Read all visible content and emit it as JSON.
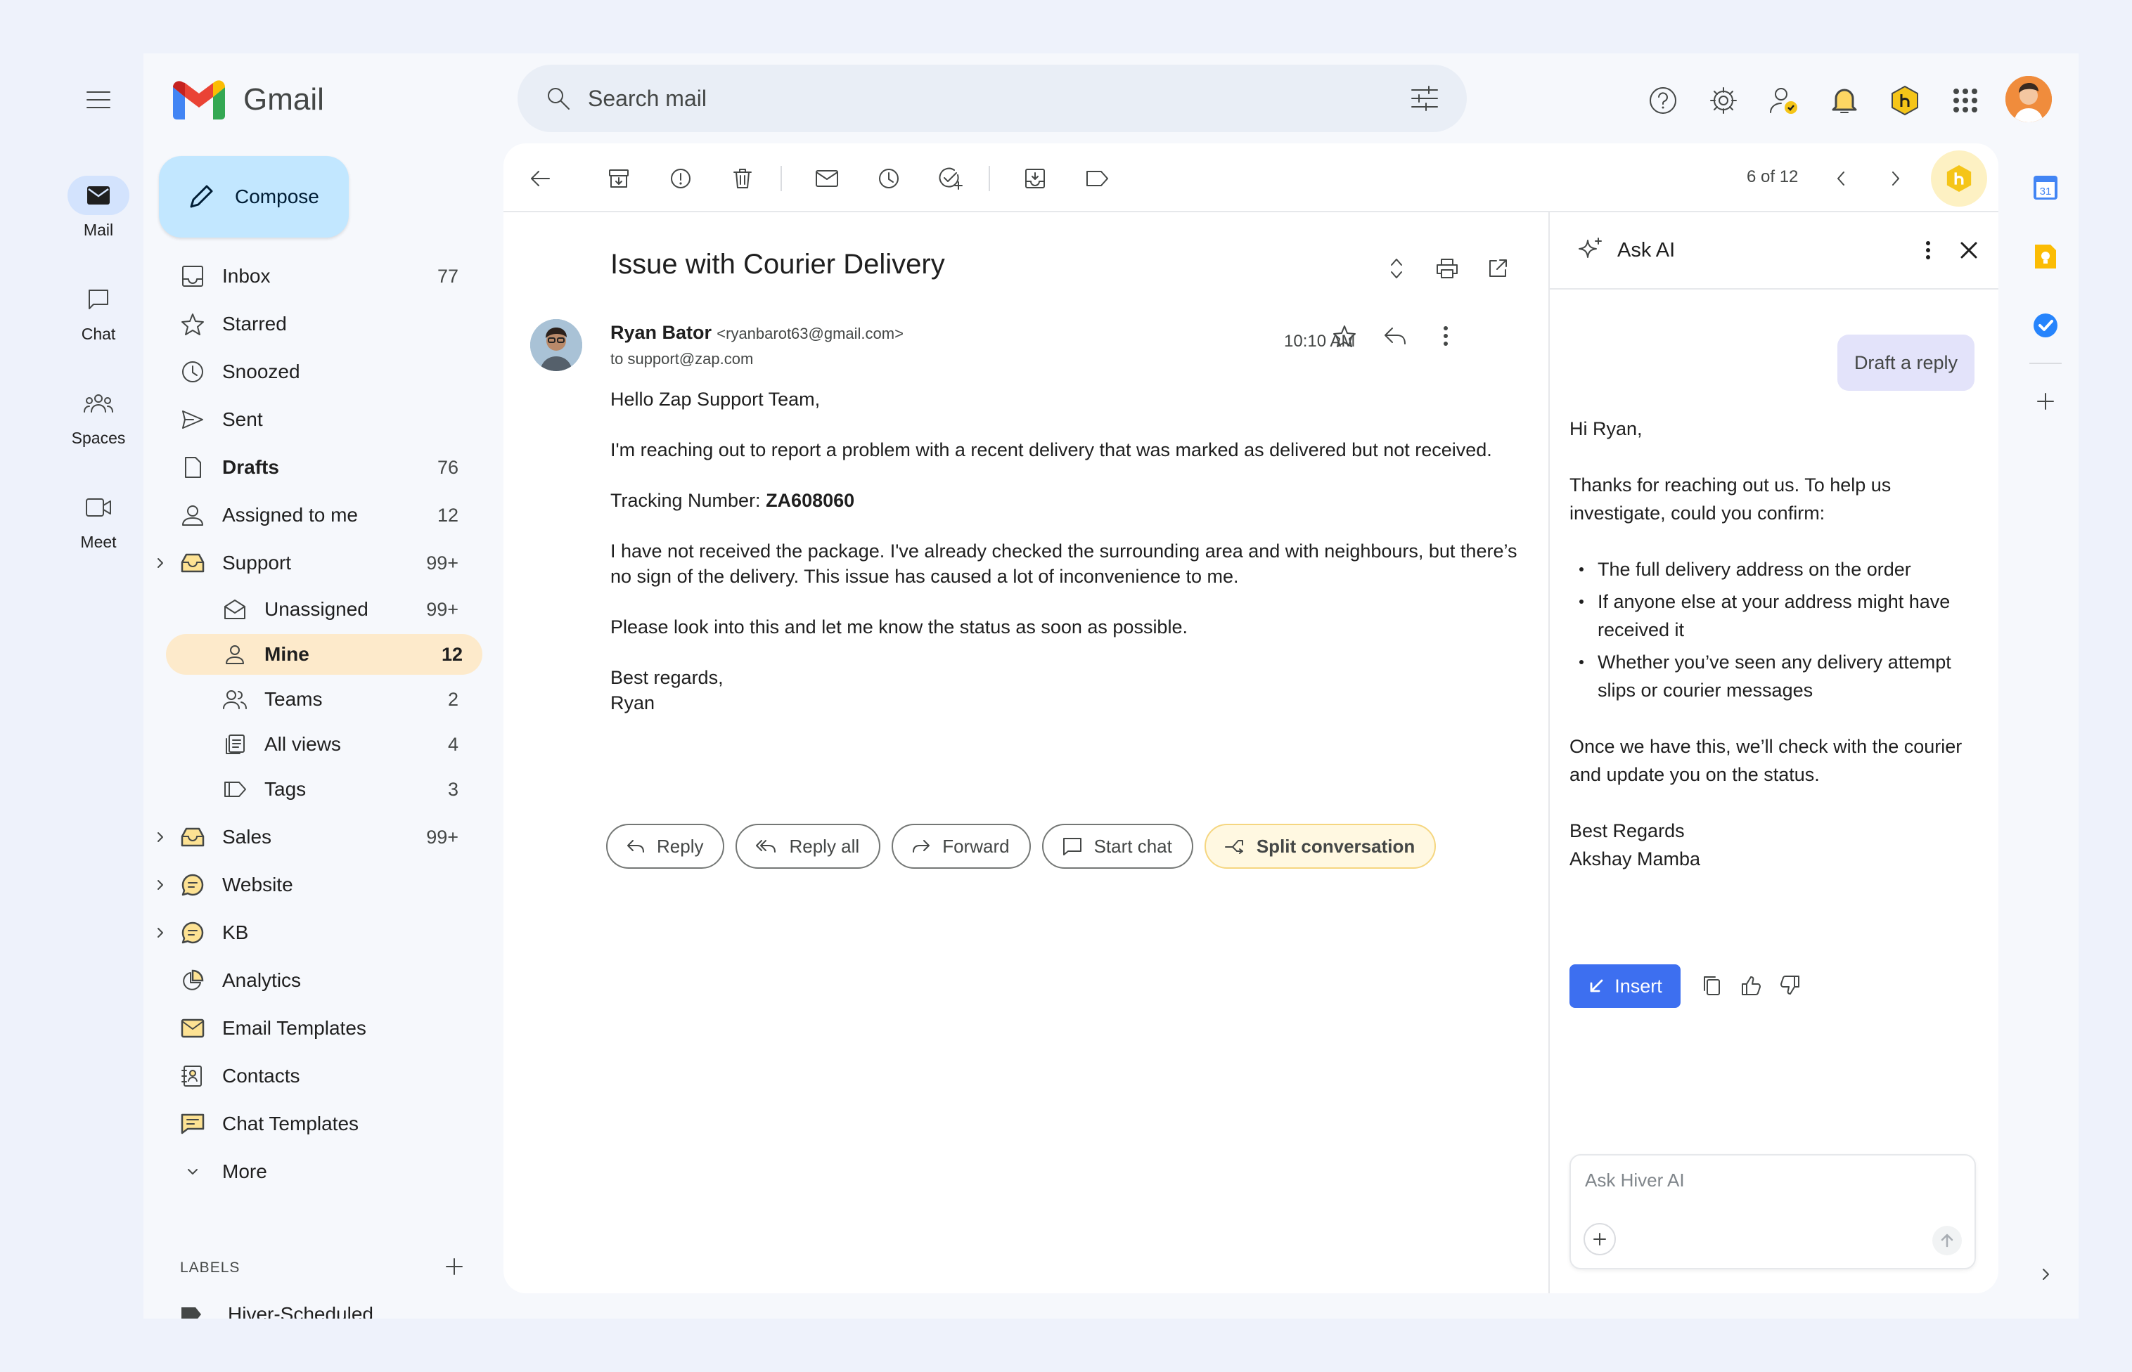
{
  "app": {
    "name": "Gmail"
  },
  "rail": [
    {
      "label": "Mail",
      "icon": "mail-icon",
      "active": true
    },
    {
      "label": "Chat",
      "icon": "chat-icon"
    },
    {
      "label": "Spaces",
      "icon": "spaces-icon"
    },
    {
      "label": "Meet",
      "icon": "meet-icon"
    }
  ],
  "search": {
    "placeholder": "Search mail"
  },
  "compose": {
    "label": "Compose"
  },
  "nav": {
    "inbox": {
      "label": "Inbox",
      "count": "77"
    },
    "starred": {
      "label": "Starred"
    },
    "snoozed": {
      "label": "Snoozed"
    },
    "sent": {
      "label": "Sent"
    },
    "drafts": {
      "label": "Drafts",
      "count": "76"
    },
    "assigned": {
      "label": "Assigned to me",
      "count": "12"
    },
    "support": {
      "label": "Support",
      "count": "99+"
    },
    "unassigned": {
      "label": "Unassigned",
      "count": "99+"
    },
    "mine": {
      "label": "Mine",
      "count": "12"
    },
    "teams": {
      "label": "Teams",
      "count": "2"
    },
    "allviews": {
      "label": "All views",
      "count": "4"
    },
    "tags": {
      "label": "Tags",
      "count": "3"
    },
    "sales": {
      "label": "Sales",
      "count": "99+"
    },
    "website": {
      "label": "Website"
    },
    "kb": {
      "label": "KB"
    },
    "analytics": {
      "label": "Analytics"
    },
    "emailtemplates": {
      "label": "Email Templates"
    },
    "contacts": {
      "label": "Contacts"
    },
    "chattemplates": {
      "label": "Chat Templates"
    },
    "more": {
      "label": "More"
    }
  },
  "labels": {
    "header": "LABELS",
    "first": "Hiver-Scheduled"
  },
  "toolbar": {
    "pager": "6 of 12"
  },
  "email": {
    "subject": "Issue with Courier Delivery",
    "sender_name": "Ryan Bator",
    "sender_email": "<ryanbarot63@gmail.com>",
    "to": "to support@zap.com",
    "time": "10:10 AM",
    "greeting": "Hello Zap Support Team,",
    "para1": "I'm reaching out to report a problem with a recent delivery that was marked as delivered but not received.",
    "tracking_label": "Tracking Number: ",
    "tracking_value": "ZA608060",
    "para2": "I have not received the package. I've already checked the surrounding area and with neighbours, but there’s no sign of the delivery. This issue has caused a lot of inconvenience to me.",
    "para3": "Please look into this and let me know the status as soon as possible.",
    "closing": "Best regards,",
    "signature": "Ryan"
  },
  "actions": {
    "reply": "Reply",
    "reply_all": "Reply all",
    "forward": "Forward",
    "start_chat": "Start chat",
    "split": "Split conversation"
  },
  "ai": {
    "title": "Ask AI",
    "prompt": "Draft a reply",
    "greeting": "Hi Ryan,",
    "intro": "Thanks for reaching out us. To help us investigate, could you confirm:",
    "bullets": [
      "The full delivery address on the order",
      "If anyone else at your address might have received it",
      "Whether you’ve seen any delivery attempt slips or courier messages"
    ],
    "followup": "Once we have this, we’ll check with the courier and update you on the status.",
    "signoff": "Best Regards",
    "agent": "Akshay Mamba",
    "insert_label": "Insert",
    "input_placeholder": "Ask Hiver AI"
  },
  "side": {
    "calendar_day": "31"
  },
  "colors": {
    "accent": "#3d6ff0",
    "compose_bg": "#c2e7ff",
    "active_nav": "#fdeacb",
    "hiver_yellow": "#f5c518"
  }
}
